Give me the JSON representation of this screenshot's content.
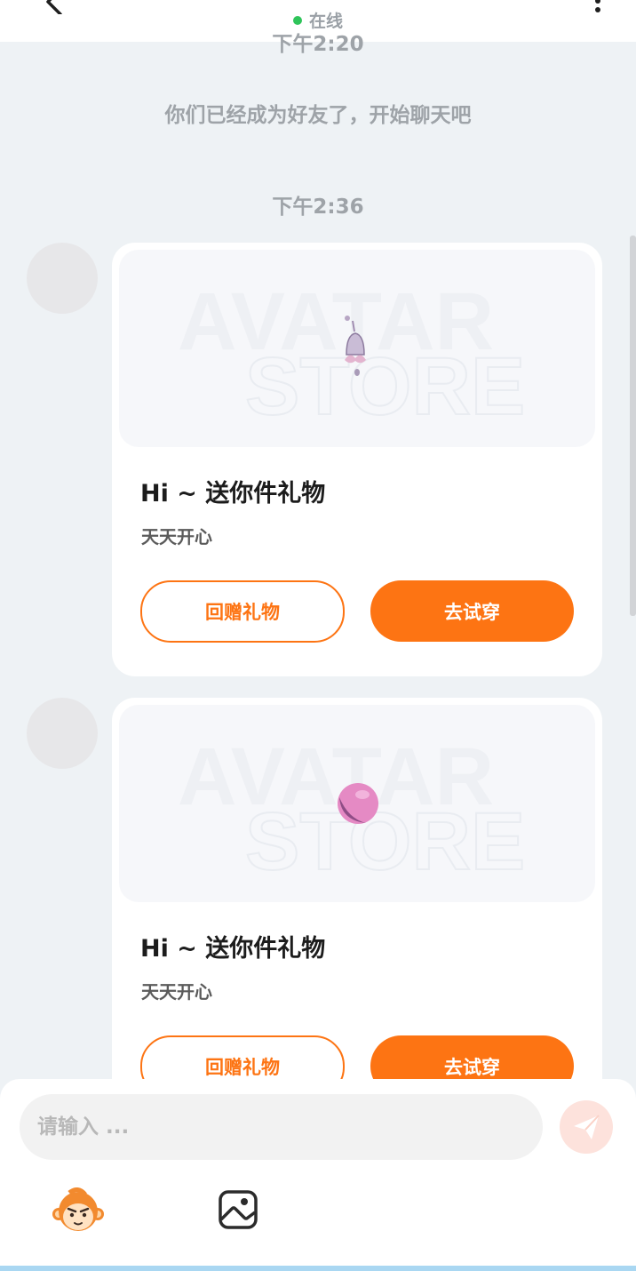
{
  "header": {
    "status": "在线",
    "status_color": "#2fc45a",
    "back_icon": "back-arrow-icon",
    "more_icon": "more-vertical-icon"
  },
  "messages": {
    "clipped_time": "下午2:20",
    "system_text": "你们已经成为好友了，开始聊天吧",
    "time": "下午2:36"
  },
  "cards": [
    {
      "image_icon": "bell-charm-icon",
      "watermark_line1": "AVATAR",
      "watermark_line2": "STORE",
      "title": "Hi ~ 送你件礼物",
      "subtitle": "天天开心",
      "return_label": "回赠礼物",
      "try_label": "去试穿"
    },
    {
      "image_icon": "pink-ball-icon",
      "watermark_line1": "AVATAR",
      "watermark_line2": "STORE",
      "title": "Hi ~ 送你件礼物",
      "subtitle": "天天开心",
      "return_label": "回赠礼物",
      "try_label": "去试穿"
    }
  ],
  "composer": {
    "placeholder": "请输入 ...",
    "send_icon": "send-paper-plane-icon",
    "emoji_icon": "monkey-emoji-icon",
    "image_icon": "image-picker-icon"
  },
  "colors": {
    "accent": "#fd7413",
    "background": "#eef2f5"
  }
}
